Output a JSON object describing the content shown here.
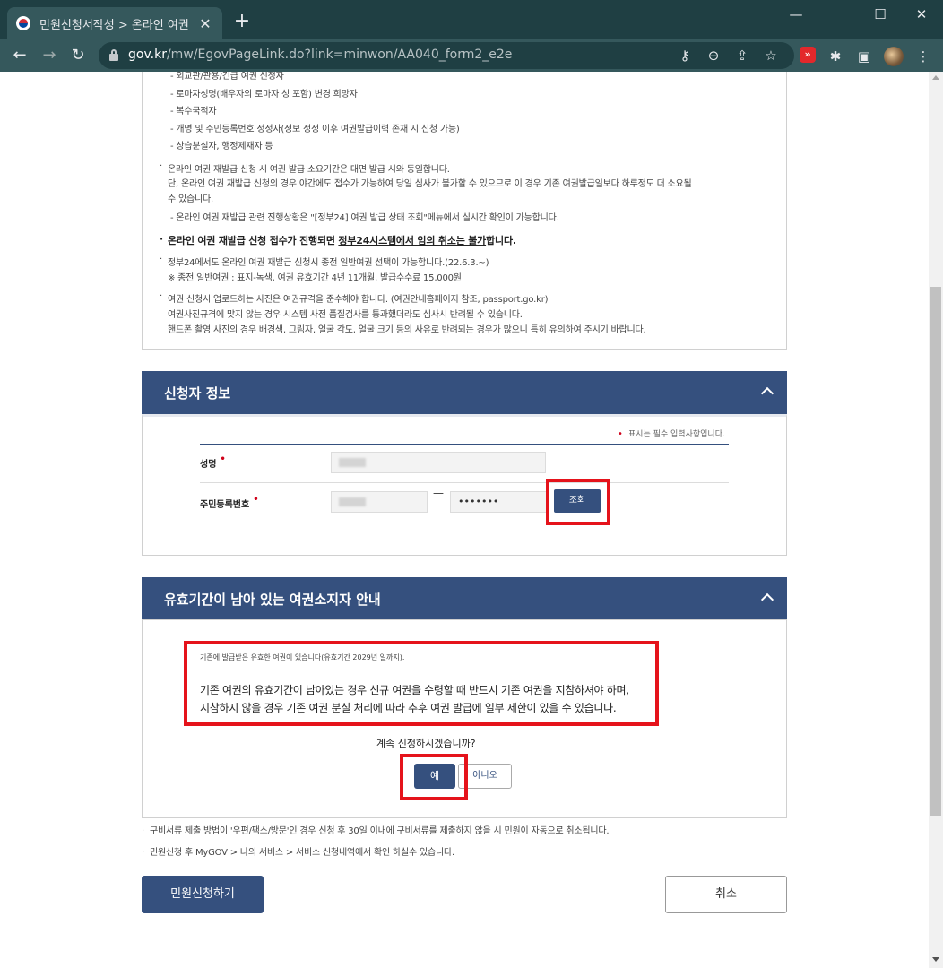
{
  "browser": {
    "tab_title": "민원신청서작성 > 온라인 여권 재",
    "tab_close": "✕",
    "new_tab": "+",
    "win_min": "—",
    "win_max": "☐",
    "win_close": "✕",
    "back": "←",
    "forward": "→",
    "reload": "↻",
    "url_host": "gov.kr",
    "url_path": "/mw/EgovPageLink.do?link=minwon/AA040_form2_e2e"
  },
  "notice": {
    "lines": [
      "- 외교관/관용/긴급 여권 신청자",
      "- 로마자성명(배우자의 로마자 성 포함) 변경 희망자",
      "- 복수국적자",
      "- 개명 및 주민등록번호 정정자(정보 정정 이후 여권발급이력 존재 시 신청 가능)",
      "- 상습분실자, 행정제재자 등"
    ],
    "p2_1": "온라인 여권 재발급 신청 시 여권 발급 소요기간은 대면 발급 시와 동일합니다.",
    "p2_2": "단, 온라인 여권 재발급 신청의 경우 야간에도 접수가 가능하여 당일 심사가 불가할 수 있으므로 이 경우 기존 여권발급일보다 하루정도 더 소요될",
    "p2_3": "수 있습니다.",
    "p2_4": "- 온라인 여권 재발급 관련 진행상황은 \"[정부24] 여권 발급 상태 조회\"메뉴에서 실시간 확인이 가능합니다.",
    "p3_a": "온라인 여권 재발급 신청 접수가 진행되면 ",
    "p3_b": "정부24시스템에서 임의 취소는 불가",
    "p3_c": "합니다.",
    "p4_1": "정부24에서도 온라인 여권 재발급 신청시 종전 일반여권 선택이 가능합니다.(22.6.3.~)",
    "p4_2": "※ 종전 일반여권 : 표지-녹색, 여권 유효기간 4년 11개월, 발급수수료 15,000원",
    "p5_1": "여권 신청시 업로드하는 사진은 여권규격을 준수해야 합니다. (여권안내홈페이지 참조, passport.go.kr)",
    "p5_2": "여권사진규격에 맞지 않는 경우 시스템 사전 품질검사를 통과했더라도 심사시 반려될 수 있습니다.",
    "p5_3": "핸드폰 촬영 사진의 경우 배경색, 그림자, 얼굴 각도, 얼굴 크기 등의 사유로 반려되는 경우가 많으니 특히 유의하여 주시기 바랍니다."
  },
  "applicant": {
    "title": "신청자 정보",
    "required_note": "표시는 필수 입력사항입니다.",
    "name_label": "성명",
    "rrn_label": "주민등록번호",
    "rrn_dash": "—",
    "rrn_back": "•••••••",
    "search_button": "조회"
  },
  "passport_holder": {
    "title": "유효기간이 남아 있는 여권소지자 안내",
    "small_msg": "기존에 발급받은 유효한 여권이 있습니다(유효기간 2029년       일까지).",
    "big_msg_1": "기존 여권의 유효기간이 남아있는 경우 신규 여권을 수령할 때 반드시 기존 여권을 지참하셔야 하며,",
    "big_msg_2": "지참하지 않을 경우 기존 여권 분실 처리에 따라 추후 여권 발급에 일부 제한이 있을 수 있습니다.",
    "question": "계속 신청하시겠습니까?",
    "yes": "예",
    "no": "아니오"
  },
  "footer": {
    "note1": "구비서류 제출 방법이 '우편/팩스/방문'인 경우 신청 후 30일 이내에 구비서류를 제출하지 않을 시 민원이 자동으로 취소됩니다.",
    "note2": "민원신청 후 MyGOV > 나의 서비스 > 서비스 신청내역에서 확인 하실수 있습니다.",
    "apply_button": "민원신청하기",
    "cancel_button": "취소"
  },
  "colors": {
    "primary": "#35507e",
    "highlight": "#e5131b",
    "chrome_dark": "#1f3f43",
    "chrome_light": "#35585c"
  }
}
